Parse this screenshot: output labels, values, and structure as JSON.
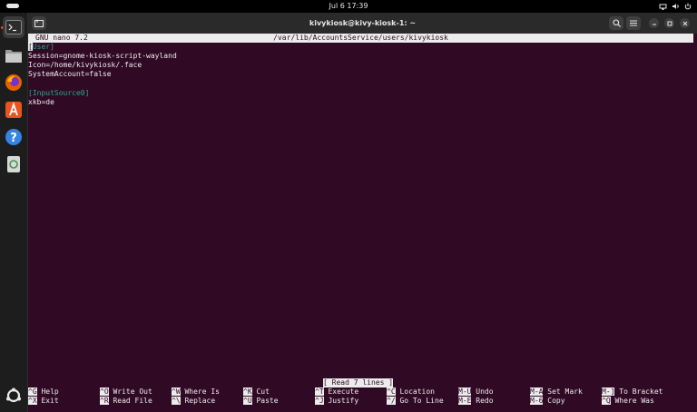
{
  "topbar": {
    "clock": "Jul 6  17:39"
  },
  "dock": {
    "items": [
      "terminal",
      "files",
      "firefox",
      "app-center",
      "help",
      "trash",
      "show-apps"
    ]
  },
  "window": {
    "title": "kivykiosk@kivy-kiosk-1: ~"
  },
  "nano": {
    "version": "GNU nano 7.2",
    "path": "/var/lib/AccountsService/users/kivykiosk",
    "cursor_char": "[",
    "line1_rest": "User]",
    "line2": "Session=gnome-kiosk-script-wayland",
    "line3": "Icon=/home/kivykiosk/.face",
    "line4": "SystemAccount=false",
    "line6": "[InputSource0]",
    "line7": "xkb=de",
    "status": "[ Read 7 lines ]",
    "shortcuts": [
      {
        "key": "^G",
        "label": "Help"
      },
      {
        "key": "^O",
        "label": "Write Out"
      },
      {
        "key": "^W",
        "label": "Where Is"
      },
      {
        "key": "^K",
        "label": "Cut"
      },
      {
        "key": "^T",
        "label": "Execute"
      },
      {
        "key": "^C",
        "label": "Location"
      },
      {
        "key": "M-U",
        "label": "Undo"
      },
      {
        "key": "M-A",
        "label": "Set Mark"
      },
      {
        "key": "M-]",
        "label": "To Bracket"
      },
      {
        "key": "^X",
        "label": "Exit"
      },
      {
        "key": "^R",
        "label": "Read File"
      },
      {
        "key": "^\\",
        "label": "Replace"
      },
      {
        "key": "^U",
        "label": "Paste"
      },
      {
        "key": "^J",
        "label": "Justify"
      },
      {
        "key": "^/",
        "label": "Go To Line"
      },
      {
        "key": "M-E",
        "label": "Redo"
      },
      {
        "key": "M-6",
        "label": "Copy"
      },
      {
        "key": "^Q",
        "label": "Where Was"
      }
    ]
  }
}
